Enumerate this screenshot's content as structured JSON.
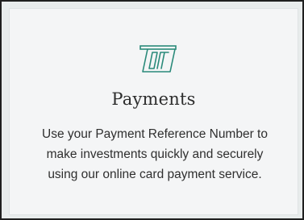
{
  "card": {
    "icon": "card-payment-terminal-icon",
    "accent_color": "#2a8a7a",
    "title": "Payments",
    "description": "Use your Payment Reference Number to make investments quickly and securely using our online card payment service."
  }
}
